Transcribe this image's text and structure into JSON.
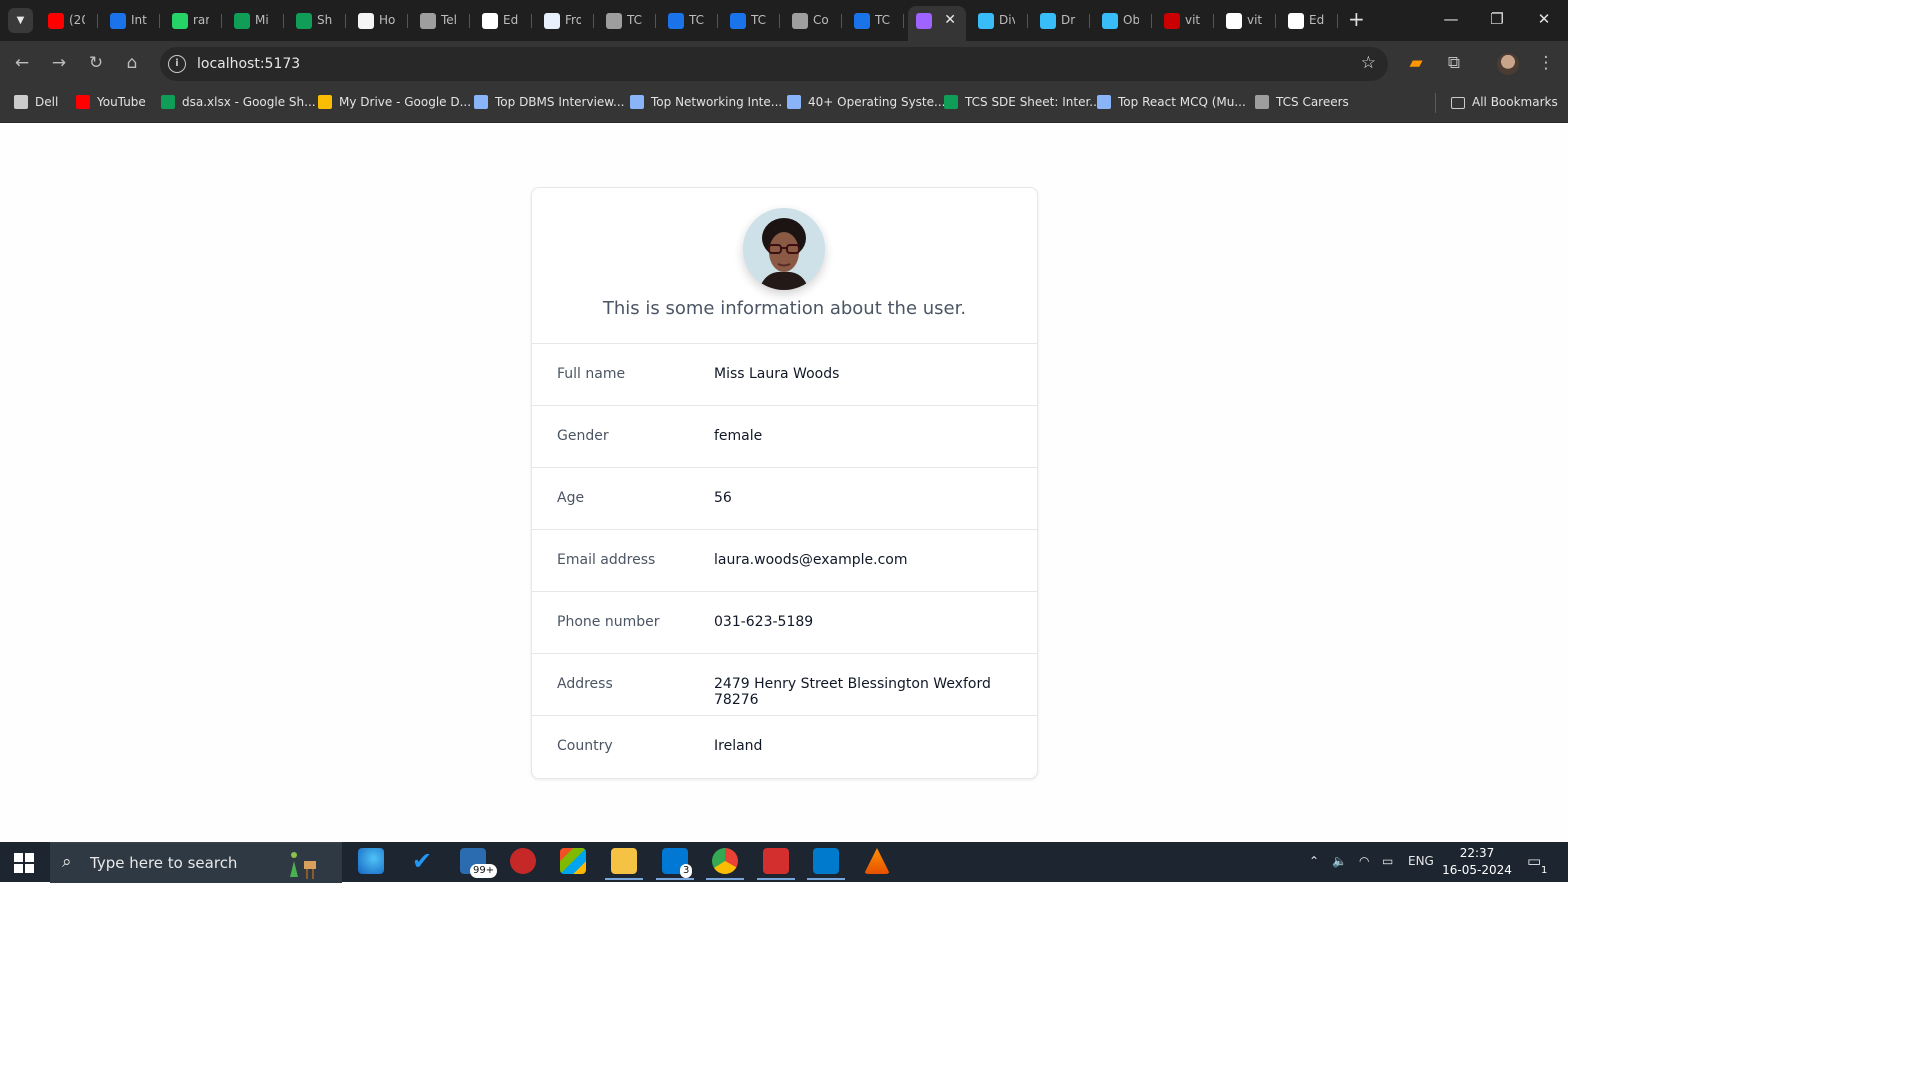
{
  "browser": {
    "tabs": [
      {
        "icon": "youtube-icon",
        "title": "(20",
        "color": "#ff0000"
      },
      {
        "icon": "interviewsite-icon",
        "title": "Int",
        "color": "#1a73e8"
      },
      {
        "icon": "whatsapp-icon",
        "title": "rar",
        "color": "#25d366"
      },
      {
        "icon": "gfg-icon",
        "title": "Mi",
        "color": "#0f9d58"
      },
      {
        "icon": "gfg-icon",
        "title": "Sh",
        "color": "#0f9d58"
      },
      {
        "icon": "doc-icon",
        "title": "Ho",
        "color": "#f4f4f4"
      },
      {
        "icon": "globe-icon",
        "title": "Tel",
        "color": "#9e9e9e"
      },
      {
        "icon": "github-icon",
        "title": "Ed",
        "color": "#ffffff"
      },
      {
        "icon": "doc-icon",
        "title": "Fro",
        "color": "#e8f0fe"
      },
      {
        "icon": "globe-icon",
        "title": "TC",
        "color": "#9e9e9e"
      },
      {
        "icon": "power-icon",
        "title": "TC",
        "color": "#1a73e8"
      },
      {
        "icon": "power-icon",
        "title": "TC",
        "color": "#1a73e8"
      },
      {
        "icon": "globe-icon",
        "title": "Co",
        "color": "#9e9e9e"
      },
      {
        "icon": "power-icon",
        "title": "TC",
        "color": "#1a73e8"
      },
      {
        "icon": "vite-icon",
        "title": "",
        "color": "#9f63ff",
        "active": true
      },
      {
        "icon": "tailwind-icon",
        "title": "Div",
        "color": "#38bdf8"
      },
      {
        "icon": "tailwind-icon",
        "title": "Dr",
        "color": "#38bdf8"
      },
      {
        "icon": "tailwind-icon",
        "title": "Ob",
        "color": "#38bdf8"
      },
      {
        "icon": "npm-icon",
        "title": "vit",
        "color": "#cb0000"
      },
      {
        "icon": "github-icon",
        "title": "vit",
        "color": "#ffffff"
      },
      {
        "icon": "github-icon",
        "title": "Ed",
        "color": "#ffffff"
      }
    ],
    "url": "localhost:5173",
    "bookmarks": [
      {
        "icon": "folder-icon",
        "label": "Dell",
        "color": "#cccccc"
      },
      {
        "icon": "youtube-icon",
        "label": "YouTube",
        "color": "#ff0000"
      },
      {
        "icon": "sheets-icon",
        "label": "dsa.xlsx - Google Sh...",
        "color": "#0f9d58"
      },
      {
        "icon": "drive-icon",
        "label": "My Drive - Google D...",
        "color": "#fbbc04"
      },
      {
        "icon": "mountain-icon",
        "label": "Top DBMS Interview...",
        "color": "#8ab4f8"
      },
      {
        "icon": "mountain-icon",
        "label": "Top Networking Inte...",
        "color": "#8ab4f8"
      },
      {
        "icon": "mountain-icon",
        "label": "40+ Operating Syste...",
        "color": "#8ab4f8"
      },
      {
        "icon": "gfg-icon",
        "label": "TCS SDE Sheet: Inter...",
        "color": "#0f9d58"
      },
      {
        "icon": "mountain-icon",
        "label": "Top React MCQ (Mu...",
        "color": "#8ab4f8"
      },
      {
        "icon": "globe-icon",
        "label": "TCS Careers",
        "color": "#9e9e9e"
      }
    ],
    "all_bookmarks": "All Bookmarks"
  },
  "profile": {
    "description": "This is some information about the user.",
    "fields": [
      {
        "label": "Full name",
        "value": "Miss Laura Woods"
      },
      {
        "label": "Gender",
        "value": "female"
      },
      {
        "label": "Age",
        "value": "56"
      },
      {
        "label": "Email address",
        "value": "laura.woods@example.com"
      },
      {
        "label": "Phone number",
        "value": "031-623-5189"
      },
      {
        "label": "Address",
        "value": "2479 Henry Street Blessington Wexford 78276"
      },
      {
        "label": "Country",
        "value": "Ireland"
      }
    ]
  },
  "taskbar": {
    "search_placeholder": "Type here to search",
    "mail_badge": "3",
    "store_badge": "99+",
    "language": "ENG",
    "time": "22:37",
    "date": "16-05-2024",
    "notification_count": "1"
  }
}
